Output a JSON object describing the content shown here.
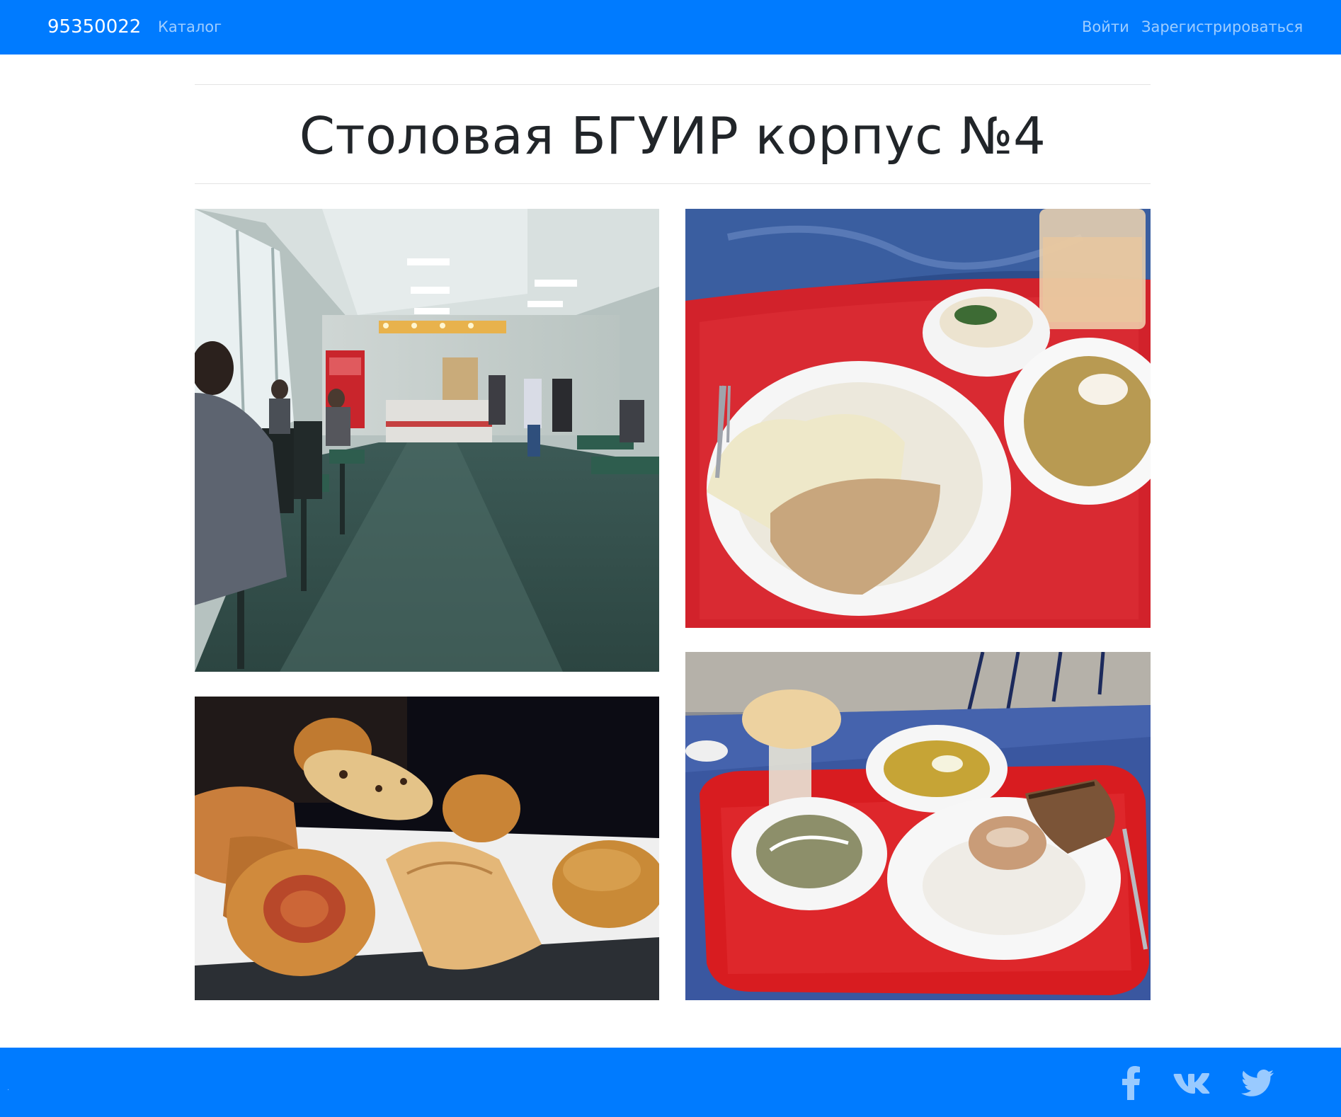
{
  "navbar": {
    "brand": "95350022",
    "catalog_label": "Каталог",
    "login_label": "Войти",
    "register_label": "Зарегистрироваться",
    "background_color": "#007bff"
  },
  "main": {
    "title": "Столовая БГУИР корпус №4",
    "photos": [
      {
        "icon": "cafeteria-hall-photo"
      },
      {
        "icon": "porridge-and-soup-photo"
      },
      {
        "icon": "pastries-photo"
      },
      {
        "icon": "lunch-tray-photo"
      }
    ]
  },
  "footer": {
    "background_color": "#007bff",
    "social": [
      {
        "icon": "facebook-icon"
      },
      {
        "icon": "vk-icon"
      },
      {
        "icon": "twitter-icon"
      }
    ]
  }
}
